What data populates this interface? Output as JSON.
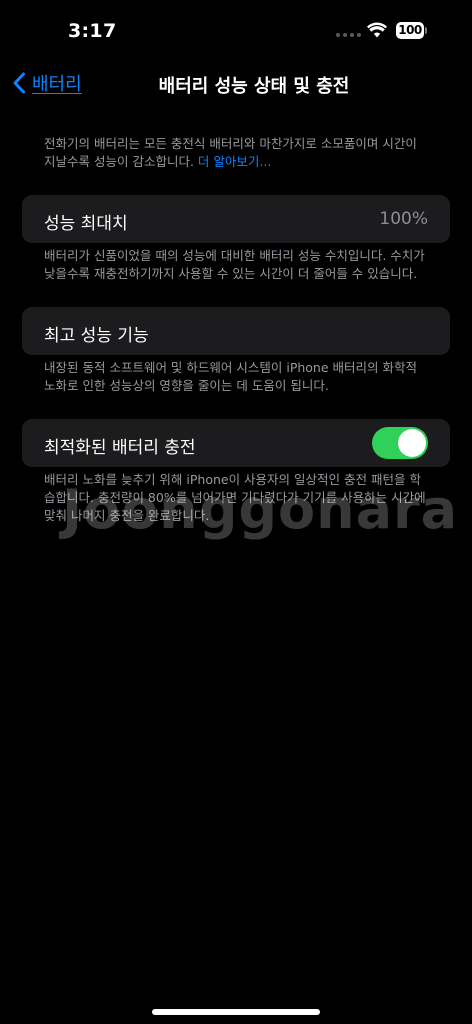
{
  "status_bar": {
    "time": "3:17",
    "battery_level": "100"
  },
  "nav": {
    "back_label": "배터리",
    "title": "배터리 성능 상태 및 충전"
  },
  "intro": {
    "text": "전화기의 배터리는 모든 충전식 배터리와 마찬가지로 소모품이며 시간이 지날수록 성능이 감소합니다.",
    "link": "더 알아보기..."
  },
  "max_capacity": {
    "label": "성능 최대치",
    "value": "100%",
    "footnote": "배터리가 신품이었을 때의 성능에 대비한 배터리 성능 수치입니다. 수치가 낮을수록 재충전하기까지 사용할 수 있는 시간이 더 줄어들 수 있습니다."
  },
  "peak_performance": {
    "label": "최고 성능 기능",
    "footnote": "내장된 동적 소프트웨어 및 하드웨어 시스템이 iPhone 배터리의 화학적 노화로 인한 성능상의 영향을 줄이는 데 도움이 됩니다."
  },
  "optimized_charging": {
    "label": "최적화된 배터리 충전",
    "enabled": true,
    "toggle_color": "#30d158",
    "footnote": "배터리 노화를 늦추기 위해 iPhone이 사용자의 일상적인 충전 패턴을 학습합니다. 충전량이 80%를 넘어가면 기다렸다가 기기를 사용하는 시간에 맞춰 나머지 충전을 완료합니다."
  },
  "watermark": "Joonggonara",
  "colors": {
    "accent": "#0a84ff",
    "background": "#000000",
    "cell": "#1c1c1e",
    "secondary_text": "#98989f"
  }
}
